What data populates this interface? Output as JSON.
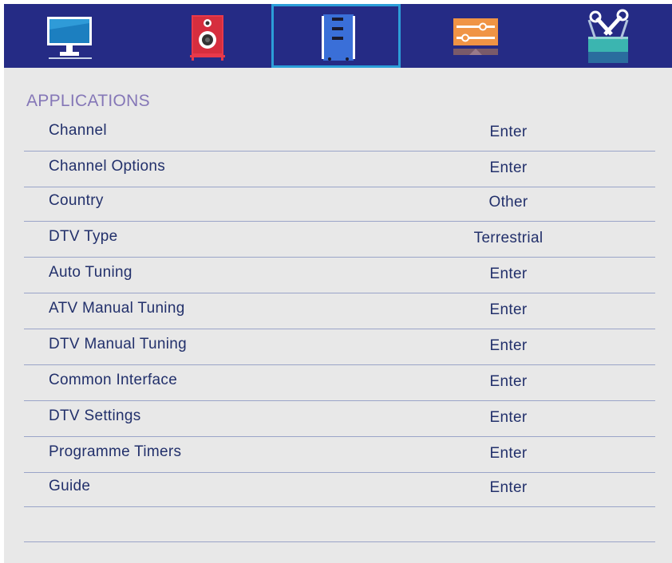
{
  "tabs": [
    {
      "icon": "monitor-icon",
      "selected": false
    },
    {
      "icon": "speaker-icon",
      "selected": false
    },
    {
      "icon": "channel-icon",
      "selected": true
    },
    {
      "icon": "sliders-icon",
      "selected": false
    },
    {
      "icon": "tools-icon",
      "selected": false
    }
  ],
  "section": {
    "title": "APPLICATIONS"
  },
  "menu": {
    "items": [
      {
        "label": "Channel",
        "value": "Enter"
      },
      {
        "label": "Channel Options",
        "value": "Enter"
      },
      {
        "label": "Country",
        "value": "Other"
      },
      {
        "label": "DTV Type",
        "value": "Terrestrial"
      },
      {
        "label": "Auto Tuning",
        "value": "Enter"
      },
      {
        "label": "ATV Manual Tuning",
        "value": "Enter"
      },
      {
        "label": "DTV Manual Tuning",
        "value": "Enter"
      },
      {
        "label": "Common Interface",
        "value": "Enter"
      },
      {
        "label": "DTV Settings",
        "value": "Enter"
      },
      {
        "label": "Programme Timers",
        "value": "Enter"
      },
      {
        "label": "Guide",
        "value": "Enter"
      }
    ]
  },
  "colors": {
    "tab_bar": "#252b85",
    "selected_border": "#2c9ed8",
    "background": "#e8e8e8",
    "title": "#8577b7",
    "text": "#22306b",
    "divider": "#9aa4c8"
  }
}
